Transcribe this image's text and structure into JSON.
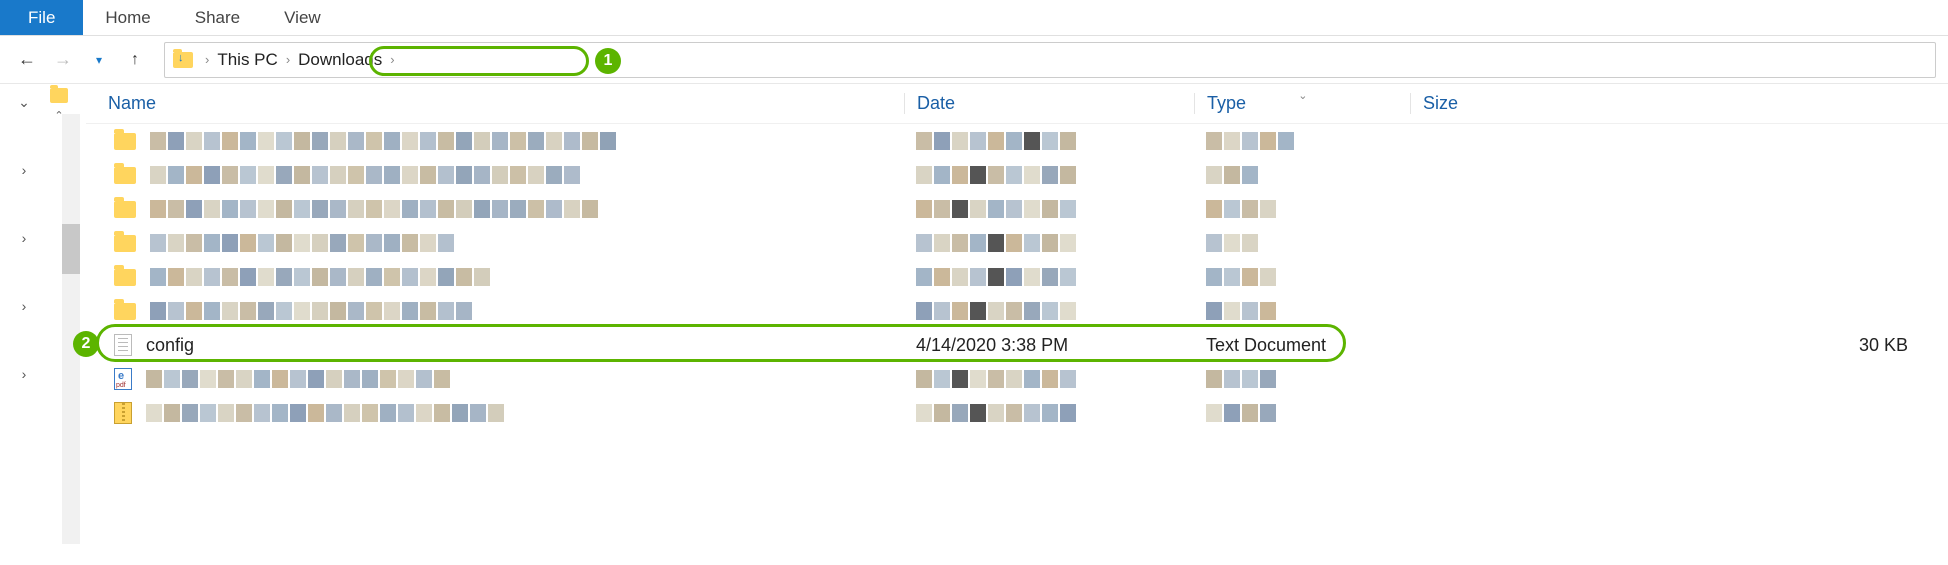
{
  "ribbon": {
    "file": "File",
    "home": "Home",
    "share": "Share",
    "view": "View"
  },
  "breadcrumb": {
    "root": "This PC",
    "folder": "Downloads"
  },
  "columns": {
    "name": "Name",
    "date": "Date",
    "type": "Type",
    "size": "Size"
  },
  "file_row": {
    "name": "config",
    "date": "4/14/2020 3:38 PM",
    "type": "Text Document",
    "size": "30 KB"
  },
  "annotations": {
    "step1": "1",
    "step2": "2"
  }
}
